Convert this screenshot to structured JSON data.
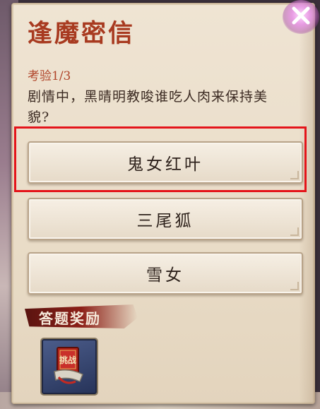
{
  "dialog": {
    "title": "逢魔密信",
    "round_label": "考验1/3",
    "question": "剧情中，黑晴明教唆谁吃人肉来保持美貌?",
    "close_icon": "close-x-icon"
  },
  "options": [
    {
      "label": "鬼女红叶",
      "highlighted": true
    },
    {
      "label": "三尾狐",
      "highlighted": false
    },
    {
      "label": "雪女",
      "highlighted": false
    }
  ],
  "reward": {
    "label": "答题奖励",
    "item_icon": "challenge-scroll-icon",
    "item_text": "挑战"
  },
  "colors": {
    "accent_red": "#a83a20",
    "highlight_border": "#e4141a",
    "panel_bg": "#efe4d3"
  }
}
